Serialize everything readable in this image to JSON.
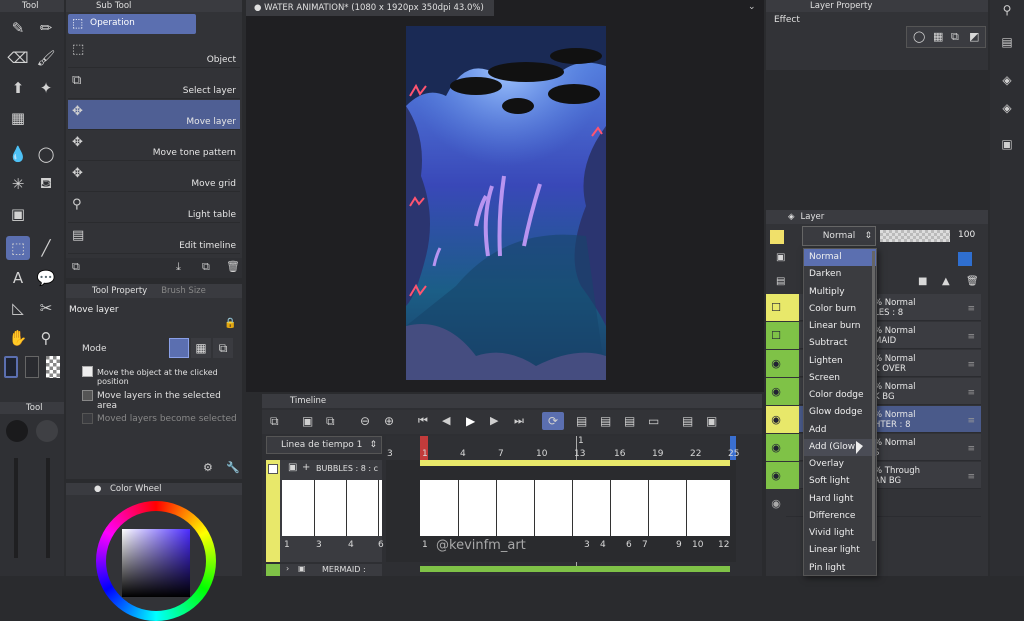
{
  "tools": {
    "title": "Tool"
  },
  "subtool": {
    "title": "Sub Tool",
    "group": "Operation",
    "items": [
      "Object",
      "Select layer",
      "Move layer",
      "Move tone pattern",
      "Move grid",
      "Light table",
      "Edit timeline"
    ]
  },
  "toolprop": {
    "tab1": "Tool Property",
    "tab2": "Brush Size",
    "name": "Move layer",
    "mode": "Mode",
    "opt1": "Move the object at the clicked position",
    "opt2": "Move layers in the selected area",
    "opt3": "Moved layers become selected"
  },
  "colorwheel": {
    "title": "Color Wheel",
    "mini_title": "Tool"
  },
  "canvas": {
    "tab": "WATER ANIMATION* (1080 x 1920px 350dpi 43.0%)",
    "watermark": "@kevinfm_art"
  },
  "timeline": {
    "title": "Timeline",
    "dropdown": "Linea de tiempo 1",
    "ruler": [
      "3",
      "1",
      "4",
      "7",
      "10",
      "13",
      "16",
      "19",
      "22",
      "25"
    ],
    "track1": "BUBBLES : 8 : c",
    "track2": "MERMAID :",
    "cel_left": [
      "1",
      "3",
      "4",
      "6"
    ],
    "cel_right": [
      "1",
      "3",
      "4",
      "6",
      "7",
      "9",
      "10",
      "12"
    ],
    "marker": "1"
  },
  "layerprop": {
    "title": "Layer Property",
    "effect": "Effect"
  },
  "layer": {
    "title": "Layer",
    "blend": "Normal",
    "opacity": "100",
    "rows": [
      {
        "mode": "% Normal",
        "name": "LES : 8"
      },
      {
        "mode": "% Normal",
        "name": "MAID"
      },
      {
        "mode": "% Normal",
        "name": "K OVER"
      },
      {
        "mode": "% Normal",
        "name": "K BG"
      },
      {
        "mode": "% Normal",
        "name": "HTER : 8"
      },
      {
        "mode": "% Normal",
        "name": "S"
      },
      {
        "mode": "% Through",
        "name": "AN BG"
      }
    ]
  },
  "blend_menu": [
    "Normal",
    "Darken",
    "Multiply",
    "Color burn",
    "Linear burn",
    "Subtract",
    "Lighten",
    "Screen",
    "Color dodge",
    "Glow dodge",
    "Add",
    "Add (Glow)",
    "Overlay",
    "Soft light",
    "Hard light",
    "Difference",
    "Vivid light",
    "Linear light",
    "Pin light"
  ],
  "colors": {
    "accent": "#5b6fb0",
    "layer_green": "#7fc247",
    "layer_yellow": "#e8e86a",
    "selected_row": "#4a5a8a",
    "canvas_bg": "#1f1f22"
  }
}
